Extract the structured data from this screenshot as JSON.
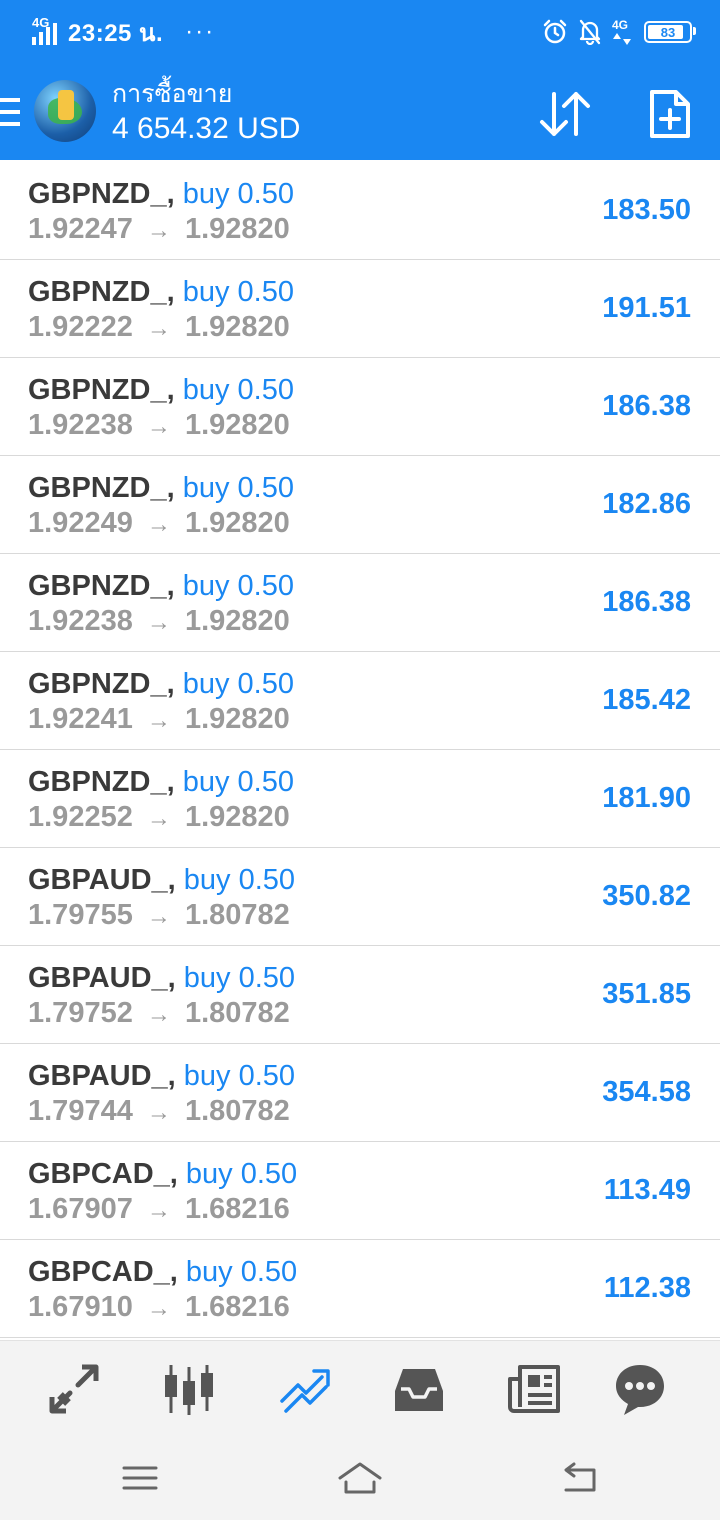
{
  "status_bar": {
    "network": "4G",
    "time": "23:25 น.",
    "more": "···",
    "network_right": "4G",
    "battery": "83"
  },
  "toolbar": {
    "title": "การซื้อขาย",
    "balance": "4 654.32 USD"
  },
  "arrow_glyph": "→",
  "positions": [
    {
      "symbol": "GBPNZD_,",
      "side": "buy 0.50",
      "open": "1.92247",
      "current": "1.92820",
      "profit": "183.50"
    },
    {
      "symbol": "GBPNZD_,",
      "side": "buy 0.50",
      "open": "1.92222",
      "current": "1.92820",
      "profit": "191.51"
    },
    {
      "symbol": "GBPNZD_,",
      "side": "buy 0.50",
      "open": "1.92238",
      "current": "1.92820",
      "profit": "186.38"
    },
    {
      "symbol": "GBPNZD_,",
      "side": "buy 0.50",
      "open": "1.92249",
      "current": "1.92820",
      "profit": "182.86"
    },
    {
      "symbol": "GBPNZD_,",
      "side": "buy 0.50",
      "open": "1.92238",
      "current": "1.92820",
      "profit": "186.38"
    },
    {
      "symbol": "GBPNZD_,",
      "side": "buy 0.50",
      "open": "1.92241",
      "current": "1.92820",
      "profit": "185.42"
    },
    {
      "symbol": "GBPNZD_,",
      "side": "buy 0.50",
      "open": "1.92252",
      "current": "1.92820",
      "profit": "181.90"
    },
    {
      "symbol": "GBPAUD_,",
      "side": "buy 0.50",
      "open": "1.79755",
      "current": "1.80782",
      "profit": "350.82"
    },
    {
      "symbol": "GBPAUD_,",
      "side": "buy 0.50",
      "open": "1.79752",
      "current": "1.80782",
      "profit": "351.85"
    },
    {
      "symbol": "GBPAUD_,",
      "side": "buy 0.50",
      "open": "1.79744",
      "current": "1.80782",
      "profit": "354.58"
    },
    {
      "symbol": "GBPCAD_,",
      "side": "buy 0.50",
      "open": "1.67907",
      "current": "1.68216",
      "profit": "113.49"
    },
    {
      "symbol": "GBPCAD_,",
      "side": "buy 0.50",
      "open": "1.67910",
      "current": "1.68216",
      "profit": "112.38"
    }
  ],
  "bottom_nav": [
    {
      "name": "quotes-icon"
    },
    {
      "name": "chart-icon"
    },
    {
      "name": "trade-icon",
      "active": true
    },
    {
      "name": "history-icon"
    },
    {
      "name": "news-icon"
    },
    {
      "name": "messages-icon"
    }
  ],
  "colors": {
    "accent": "#1a87f2",
    "symbol_text": "#3a3a3a",
    "price_text": "#9a9a9a",
    "nav_icon": "#555555"
  }
}
